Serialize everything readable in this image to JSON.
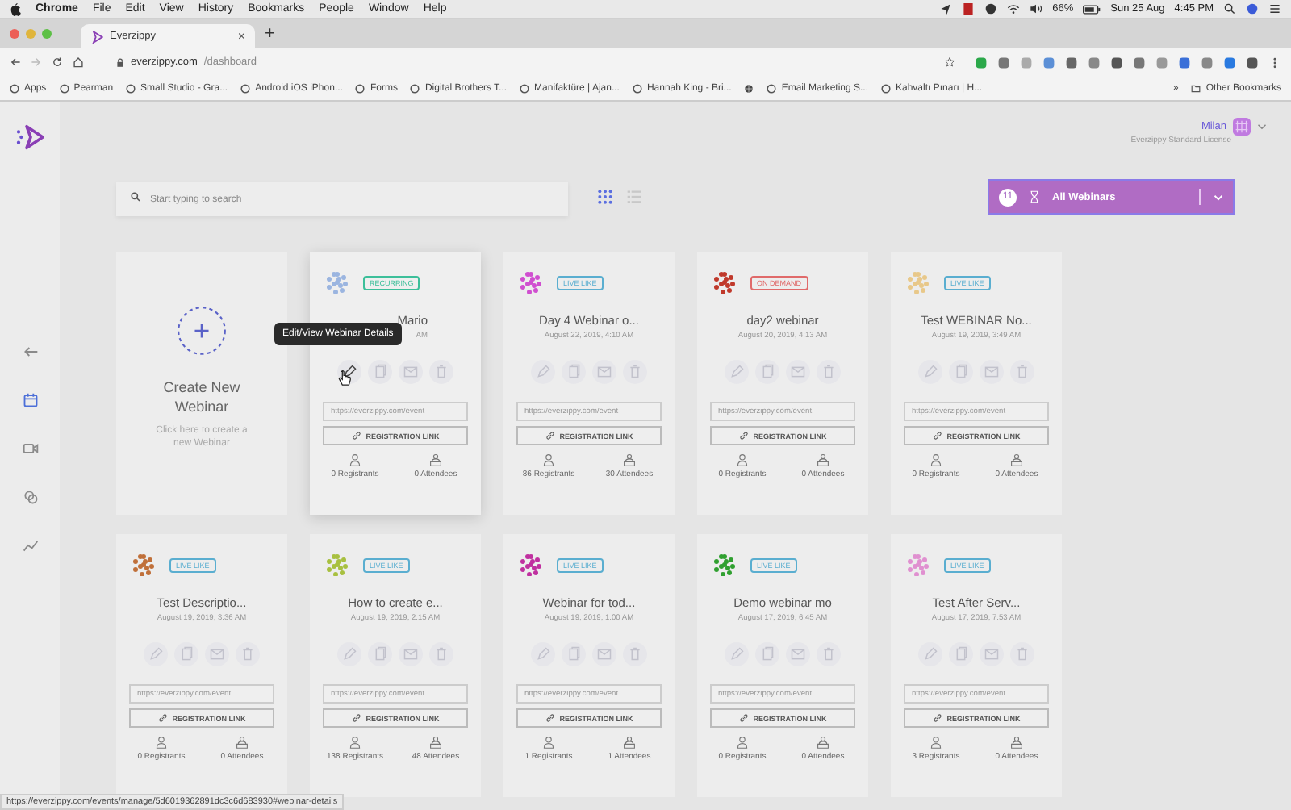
{
  "menu_bar": {
    "app": "Chrome",
    "items": [
      "File",
      "Edit",
      "View",
      "History",
      "Bookmarks",
      "People",
      "Window",
      "Help"
    ],
    "battery": "66%",
    "date": "Sun 25 Aug",
    "time": "4:45 PM"
  },
  "browser": {
    "tab": {
      "title": "Everzippy",
      "close": "×"
    },
    "new_tab": "+",
    "address": {
      "host": "everzippy.com",
      "path": "/dashboard"
    },
    "bookmarks": [
      {
        "label": "Apps"
      },
      {
        "label": "Pearman"
      },
      {
        "label": "Small Studio - Gra..."
      },
      {
        "label": "Android iOS iPhon..."
      },
      {
        "label": "Forms"
      },
      {
        "label": "Digital Brothers T..."
      },
      {
        "label": "Manifaktüre | Ajan..."
      },
      {
        "label": "Hannah King - Bri..."
      },
      {
        "kind": "icon_only"
      },
      {
        "label": "Email Marketing S..."
      },
      {
        "label": "Kahvaltı Pınarı | H..."
      }
    ],
    "more_bookmarks": "»",
    "other_bookmarks": "Other Bookmarks"
  },
  "user": {
    "name": "Milan",
    "license": "Everzippy Standard License"
  },
  "sidebar": [
    {
      "kind": "back",
      "selected": false
    },
    {
      "kind": "calendar",
      "selected": true
    },
    {
      "kind": "video",
      "selected": false
    },
    {
      "kind": "coins",
      "selected": false
    },
    {
      "kind": "chart",
      "selected": false
    }
  ],
  "search": {
    "placeholder": "Start typing to search"
  },
  "views": [
    {
      "kind": "grid",
      "selected": true
    },
    {
      "kind": "list",
      "selected": false
    }
  ],
  "filter": {
    "count": "11",
    "label": "All Webinars"
  },
  "cards": [
    {
      "kind": "create",
      "title": "Create New Webinar",
      "hint": "Click here to create a new Webinar"
    },
    {
      "kind": "webinar",
      "color": "#9bb5e0",
      "tag": {
        "label": "RECURRING",
        "color": "#3cbf9a"
      },
      "title": "Mario",
      "date": "AM",
      "tooltip": "Edit/View Webinar Details",
      "url": "https://everzippy.com/event",
      "button": "REGISTRATION LINK",
      "registrants": "0 Registrants",
      "attendees": "0 Attendees"
    },
    {
      "kind": "webinar",
      "color": "#d04fd0",
      "tag": {
        "label": "LIVE LIKE",
        "color": "#5aaed0"
      },
      "title": "Day 4 Webinar o...",
      "date": "August 22, 2019, 4:10 AM",
      "url": "https://everzippy.com/event",
      "button": "REGISTRATION LINK",
      "registrants": "86 Registrants",
      "attendees": "30 Attendees"
    },
    {
      "kind": "webinar",
      "color": "#c0392b",
      "tag": {
        "label": "ON DEMAND",
        "color": "#e06a6a"
      },
      "title": "day2 webinar",
      "date": "August 20, 2019, 4:13 AM",
      "url": "https://everzippy.com/event",
      "button": "REGISTRATION LINK",
      "registrants": "0 Registrants",
      "attendees": "0 Attendees"
    },
    {
      "kind": "webinar",
      "color": "#e8c88a",
      "tag": {
        "label": "LIVE LIKE",
        "color": "#5aaed0"
      },
      "title": "Test WEBINAR No...",
      "date": "August 19, 2019, 3:49 AM",
      "url": "https://everzippy.com/event",
      "button": "REGISTRATION LINK",
      "registrants": "0 Registrants",
      "attendees": "0 Attendees"
    },
    {
      "kind": "webinar",
      "color": "#c0703a",
      "tag": {
        "label": "LIVE LIKE",
        "color": "#5aaed0"
      },
      "title": "Test Descriptio...",
      "date": "August 19, 2019, 3:36 AM",
      "url": "https://everzippy.com/event",
      "button": "REGISTRATION LINK",
      "registrants": "0 Registrants",
      "attendees": "0 Attendees"
    },
    {
      "kind": "webinar",
      "color": "#a8c040",
      "tag": {
        "label": "LIVE LIKE",
        "color": "#5aaed0"
      },
      "title": "How to create e...",
      "date": "August 19, 2019, 2:15 AM",
      "url": "https://everzippy.com/event",
      "button": "REGISTRATION LINK",
      "registrants": "138 Registrants",
      "attendees": "48 Attendees"
    },
    {
      "kind": "webinar",
      "color": "#c030a0",
      "tag": {
        "label": "LIVE LIKE",
        "color": "#5aaed0"
      },
      "title": "Webinar for tod...",
      "date": "August 19, 2019, 1:00 AM",
      "url": "https://everzippy.com/event",
      "button": "REGISTRATION LINK",
      "registrants": "1 Registrants",
      "attendees": "1 Attendees"
    },
    {
      "kind": "webinar",
      "color": "#30a030",
      "tag": {
        "label": "LIVE LIKE",
        "color": "#5aaed0"
      },
      "title": "Demo webinar mo",
      "date": "August 17, 2019, 6:45 AM",
      "url": "https://everzippy.com/event",
      "button": "REGISTRATION LINK",
      "registrants": "0 Registrants",
      "attendees": "0 Attendees"
    },
    {
      "kind": "webinar",
      "color": "#e090d0",
      "tag": {
        "label": "LIVE LIKE",
        "color": "#5aaed0"
      },
      "title": "Test After Serv...",
      "date": "August 17, 2019, 7:53 AM",
      "url": "https://everzippy.com/event",
      "button": "REGISTRATION LINK",
      "registrants": "3 Registrants",
      "attendees": "0 Attendees"
    }
  ],
  "status_bar": "https://everzippy.com/events/manage/5d6019362891dc3c6d683930#webinar-details"
}
